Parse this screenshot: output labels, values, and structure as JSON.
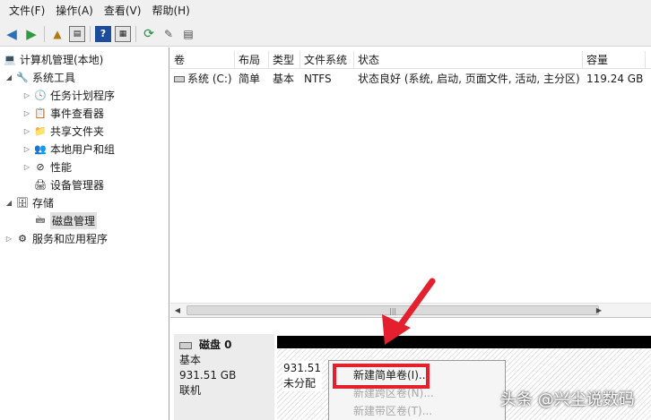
{
  "menubar": {
    "items": [
      "文件(F)",
      "操作(A)",
      "查看(V)",
      "帮助(H)"
    ]
  },
  "toolbar": {
    "icons": [
      "back-arrow-icon",
      "forward-arrow-icon",
      "up-folder-icon",
      "console-tree-icon",
      "help-icon",
      "show-hide-icon",
      "refresh-icon",
      "properties-icon",
      "disk-icon"
    ]
  },
  "tree": {
    "root": "计算机管理(本地)",
    "system_tools": "系统工具",
    "task_scheduler": "任务计划程序",
    "event_viewer": "事件查看器",
    "shared_folders": "共享文件夹",
    "local_users": "本地用户和组",
    "performance": "性能",
    "device_manager": "设备管理器",
    "storage": "存储",
    "disk_management": "磁盘管理",
    "services_apps": "服务和应用程序"
  },
  "volume_list": {
    "columns": [
      "卷",
      "布局",
      "类型",
      "文件系统",
      "状态",
      "容量"
    ],
    "rows": [
      {
        "volume": "系统 (C:)",
        "layout": "简单",
        "type": "基本",
        "fs": "NTFS",
        "status": "状态良好 (系统, 启动, 页面文件, 活动, 主分区)",
        "capacity": "119.24 GB"
      }
    ]
  },
  "disk": {
    "name": "磁盘 0",
    "type": "基本",
    "size": "931.51 GB",
    "status": "联机",
    "unallocated_size": "931.51",
    "unallocated_label": "未分配"
  },
  "context_menu": {
    "items": [
      {
        "label": "新建简单卷(I)...",
        "enabled": true
      },
      {
        "label": "新建跨区卷(N)...",
        "enabled": false
      },
      {
        "label": "新建带区卷(T)...",
        "enabled": false
      }
    ]
  },
  "watermark": "头条 @兴尘说数码",
  "colors": {
    "highlight_box": "#e5202e",
    "arrow": "#e5202e",
    "unallocated_bar": "#000000"
  }
}
